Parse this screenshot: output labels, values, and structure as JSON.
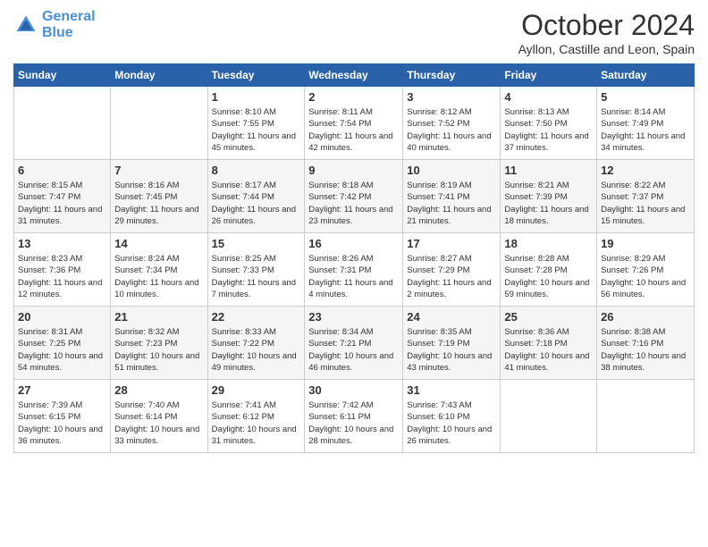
{
  "logo": {
    "line1": "General",
    "line2": "Blue"
  },
  "header": {
    "month": "October 2024",
    "location": "Ayllon, Castille and Leon, Spain"
  },
  "weekdays": [
    "Sunday",
    "Monday",
    "Tuesday",
    "Wednesday",
    "Thursday",
    "Friday",
    "Saturday"
  ],
  "weeks": [
    [
      {
        "day": "",
        "info": ""
      },
      {
        "day": "",
        "info": ""
      },
      {
        "day": "1",
        "info": "Sunrise: 8:10 AM\nSunset: 7:55 PM\nDaylight: 11 hours and 45 minutes."
      },
      {
        "day": "2",
        "info": "Sunrise: 8:11 AM\nSunset: 7:54 PM\nDaylight: 11 hours and 42 minutes."
      },
      {
        "day": "3",
        "info": "Sunrise: 8:12 AM\nSunset: 7:52 PM\nDaylight: 11 hours and 40 minutes."
      },
      {
        "day": "4",
        "info": "Sunrise: 8:13 AM\nSunset: 7:50 PM\nDaylight: 11 hours and 37 minutes."
      },
      {
        "day": "5",
        "info": "Sunrise: 8:14 AM\nSunset: 7:49 PM\nDaylight: 11 hours and 34 minutes."
      }
    ],
    [
      {
        "day": "6",
        "info": "Sunrise: 8:15 AM\nSunset: 7:47 PM\nDaylight: 11 hours and 31 minutes."
      },
      {
        "day": "7",
        "info": "Sunrise: 8:16 AM\nSunset: 7:45 PM\nDaylight: 11 hours and 29 minutes."
      },
      {
        "day": "8",
        "info": "Sunrise: 8:17 AM\nSunset: 7:44 PM\nDaylight: 11 hours and 26 minutes."
      },
      {
        "day": "9",
        "info": "Sunrise: 8:18 AM\nSunset: 7:42 PM\nDaylight: 11 hours and 23 minutes."
      },
      {
        "day": "10",
        "info": "Sunrise: 8:19 AM\nSunset: 7:41 PM\nDaylight: 11 hours and 21 minutes."
      },
      {
        "day": "11",
        "info": "Sunrise: 8:21 AM\nSunset: 7:39 PM\nDaylight: 11 hours and 18 minutes."
      },
      {
        "day": "12",
        "info": "Sunrise: 8:22 AM\nSunset: 7:37 PM\nDaylight: 11 hours and 15 minutes."
      }
    ],
    [
      {
        "day": "13",
        "info": "Sunrise: 8:23 AM\nSunset: 7:36 PM\nDaylight: 11 hours and 12 minutes."
      },
      {
        "day": "14",
        "info": "Sunrise: 8:24 AM\nSunset: 7:34 PM\nDaylight: 11 hours and 10 minutes."
      },
      {
        "day": "15",
        "info": "Sunrise: 8:25 AM\nSunset: 7:33 PM\nDaylight: 11 hours and 7 minutes."
      },
      {
        "day": "16",
        "info": "Sunrise: 8:26 AM\nSunset: 7:31 PM\nDaylight: 11 hours and 4 minutes."
      },
      {
        "day": "17",
        "info": "Sunrise: 8:27 AM\nSunset: 7:29 PM\nDaylight: 11 hours and 2 minutes."
      },
      {
        "day": "18",
        "info": "Sunrise: 8:28 AM\nSunset: 7:28 PM\nDaylight: 10 hours and 59 minutes."
      },
      {
        "day": "19",
        "info": "Sunrise: 8:29 AM\nSunset: 7:26 PM\nDaylight: 10 hours and 56 minutes."
      }
    ],
    [
      {
        "day": "20",
        "info": "Sunrise: 8:31 AM\nSunset: 7:25 PM\nDaylight: 10 hours and 54 minutes."
      },
      {
        "day": "21",
        "info": "Sunrise: 8:32 AM\nSunset: 7:23 PM\nDaylight: 10 hours and 51 minutes."
      },
      {
        "day": "22",
        "info": "Sunrise: 8:33 AM\nSunset: 7:22 PM\nDaylight: 10 hours and 49 minutes."
      },
      {
        "day": "23",
        "info": "Sunrise: 8:34 AM\nSunset: 7:21 PM\nDaylight: 10 hours and 46 minutes."
      },
      {
        "day": "24",
        "info": "Sunrise: 8:35 AM\nSunset: 7:19 PM\nDaylight: 10 hours and 43 minutes."
      },
      {
        "day": "25",
        "info": "Sunrise: 8:36 AM\nSunset: 7:18 PM\nDaylight: 10 hours and 41 minutes."
      },
      {
        "day": "26",
        "info": "Sunrise: 8:38 AM\nSunset: 7:16 PM\nDaylight: 10 hours and 38 minutes."
      }
    ],
    [
      {
        "day": "27",
        "info": "Sunrise: 7:39 AM\nSunset: 6:15 PM\nDaylight: 10 hours and 36 minutes."
      },
      {
        "day": "28",
        "info": "Sunrise: 7:40 AM\nSunset: 6:14 PM\nDaylight: 10 hours and 33 minutes."
      },
      {
        "day": "29",
        "info": "Sunrise: 7:41 AM\nSunset: 6:12 PM\nDaylight: 10 hours and 31 minutes."
      },
      {
        "day": "30",
        "info": "Sunrise: 7:42 AM\nSunset: 6:11 PM\nDaylight: 10 hours and 28 minutes."
      },
      {
        "day": "31",
        "info": "Sunrise: 7:43 AM\nSunset: 6:10 PM\nDaylight: 10 hours and 26 minutes."
      },
      {
        "day": "",
        "info": ""
      },
      {
        "day": "",
        "info": ""
      }
    ]
  ]
}
